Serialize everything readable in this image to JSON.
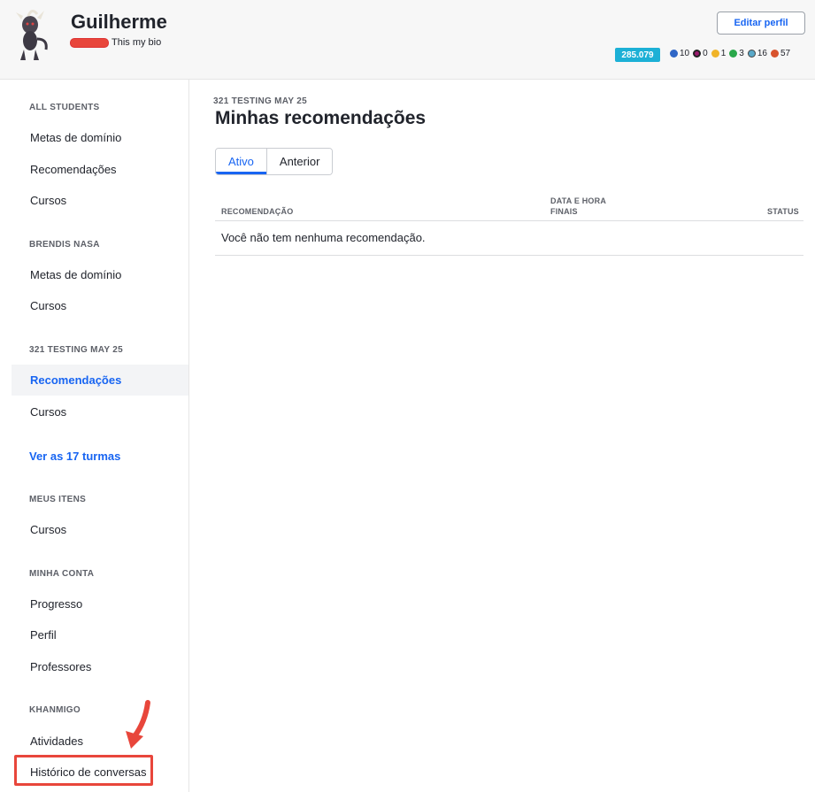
{
  "header": {
    "username": "Guilherme",
    "bio": "This my bio",
    "edit_label": "Editar perfil",
    "points": "285.079",
    "badges": [
      {
        "icon": "mastery-badge-icon",
        "count": "10",
        "color": "#2f66c6"
      },
      {
        "icon": "black-hole-badge-icon",
        "count": "0",
        "color": "#9b1a6e"
      },
      {
        "icon": "sun-badge-icon",
        "count": "1",
        "color": "#f0b429"
      },
      {
        "icon": "earth-badge-icon",
        "count": "3",
        "color": "#2aa84a"
      },
      {
        "icon": "moon-badge-icon",
        "count": "16",
        "color": "#5aa9c9"
      },
      {
        "icon": "meteorite-badge-icon",
        "count": "57",
        "color": "#d8532d"
      }
    ]
  },
  "sidebar": {
    "sections": [
      {
        "title": "ALL STUDENTS",
        "items": [
          "Metas de domínio",
          "Recomendações",
          "Cursos"
        ]
      },
      {
        "title": "BRENDIS NASA",
        "items": [
          "Metas de domínio",
          "Cursos"
        ]
      },
      {
        "title": "321 TESTING MAY 25",
        "items": [
          "Recomendações",
          "Cursos"
        ]
      },
      {
        "title": "MEUS ITENS",
        "items": [
          "Cursos"
        ]
      },
      {
        "title": "MINHA CONTA",
        "items": [
          "Progresso",
          "Perfil",
          "Professores"
        ]
      },
      {
        "title": "KHANMIGO",
        "items": [
          "Atividades",
          "Histórico de conversas"
        ]
      }
    ],
    "see_all": "Ver as 17 turmas"
  },
  "main": {
    "class_name": "321 TESTING MAY 25",
    "title": "Minhas recomendações",
    "tabs": [
      {
        "label": "Ativo",
        "active": true
      },
      {
        "label": "Anterior",
        "active": false
      }
    ],
    "table": {
      "col_recommendation": "RECOMENDAÇÃO",
      "col_due_line1": "DATA E HORA",
      "col_due_line2": "FINAIS",
      "col_status": "STATUS",
      "empty_message": "Você não tem nenhuma recomendação."
    }
  },
  "colors": {
    "accent": "#1865f2",
    "points_bg": "#1cb0d6",
    "highlight": "#e8463b"
  }
}
